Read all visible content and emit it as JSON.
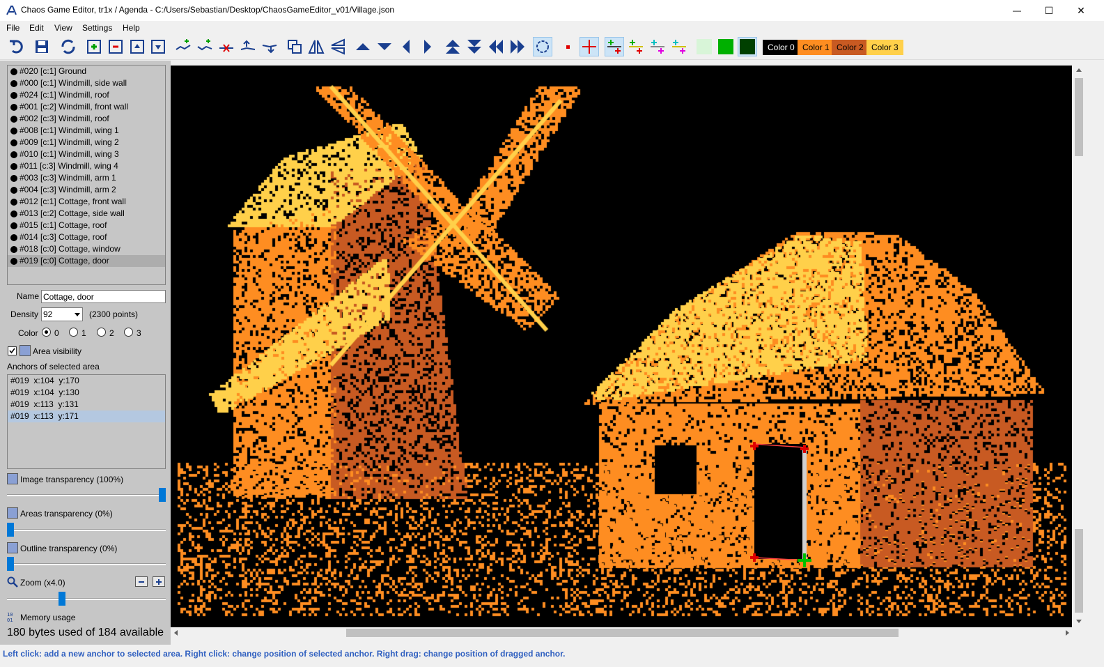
{
  "window": {
    "title": "Chaos Game Editor, tr1x / Agenda - C:/Users/Sebastian/Desktop/ChaosGameEditor_v01/Village.json",
    "minimize_glyph": "—",
    "maximize_glyph": "☐",
    "close_glyph": "✕"
  },
  "menu": [
    "File",
    "Edit",
    "View",
    "Settings",
    "Help"
  ],
  "toolbar": {
    "colors": [
      {
        "label": "Color 0",
        "bg": "#000000",
        "fg": "#ffffff"
      },
      {
        "label": "Color 1",
        "bg": "#fe8d21",
        "fg": "#000000"
      },
      {
        "label": "Color 2",
        "bg": "#c85a22",
        "fg": "#000000"
      },
      {
        "label": "Color 3",
        "bg": "#ffd04a",
        "fg": "#000000"
      }
    ],
    "swatch_colors": [
      "#d8f5d8",
      "#00b000",
      "#004000"
    ]
  },
  "areas": [
    {
      "label": "#020 [c:1] Ground"
    },
    {
      "label": "#000 [c:1] Windmill, side wall"
    },
    {
      "label": "#024 [c:1] Windmill, roof"
    },
    {
      "label": "#001 [c:2] Windmill, front wall"
    },
    {
      "label": "#002 [c:3] Windmill, roof"
    },
    {
      "label": "#008 [c:1] Windmill, wing 1"
    },
    {
      "label": "#009 [c:1] Windmill, wing 2"
    },
    {
      "label": "#010 [c:1] Windmill, wing 3"
    },
    {
      "label": "#011 [c:3] Windmill, wing 4"
    },
    {
      "label": "#003 [c:3] Windmill, arm 1"
    },
    {
      "label": "#004 [c:3] Windmill, arm 2"
    },
    {
      "label": "#012 [c:1] Cottage, front wall"
    },
    {
      "label": "#013 [c:2] Cottage, side wall"
    },
    {
      "label": "#015 [c:1] Cottage, roof"
    },
    {
      "label": "#014 [c:3] Cottage, roof"
    },
    {
      "label": "#018 [c:0] Cottage, window"
    },
    {
      "label": "#019 [c:0] Cottage, door",
      "selected": true
    }
  ],
  "props": {
    "name_label": "Name",
    "name_value": "Cottage, door",
    "density_label": "Density",
    "density_value": "92",
    "density_points": "(2300 points)",
    "color_label": "Color",
    "color_options": [
      "0",
      "1",
      "2",
      "3"
    ],
    "color_selected": 0,
    "area_visibility": "Area visibility",
    "anchors_title": "Anchors of selected area"
  },
  "anchors": [
    {
      "label": "#019  x:104  y:170"
    },
    {
      "label": "#019  x:104  y:130"
    },
    {
      "label": "#019  x:113  y:131"
    },
    {
      "label": "#019  x:113  y:171",
      "selected": true
    }
  ],
  "sliders": {
    "image_transparency": "Image transparency (100%)",
    "image_value": 1.0,
    "areas_transparency": "Areas transparency (0%)",
    "areas_value": 0.0,
    "outline_transparency": "Outline transparency (0%)",
    "outline_value": 0.0,
    "zoom": "Zoom (x4.0)",
    "zoom_value": 0.34
  },
  "memory": {
    "label": "Memory usage",
    "text": "180 bytes used of 184 available"
  },
  "status": "Left click: add a new anchor to selected area.   Right click: change position of selected anchor.   Right drag: change position of dragged anchor."
}
